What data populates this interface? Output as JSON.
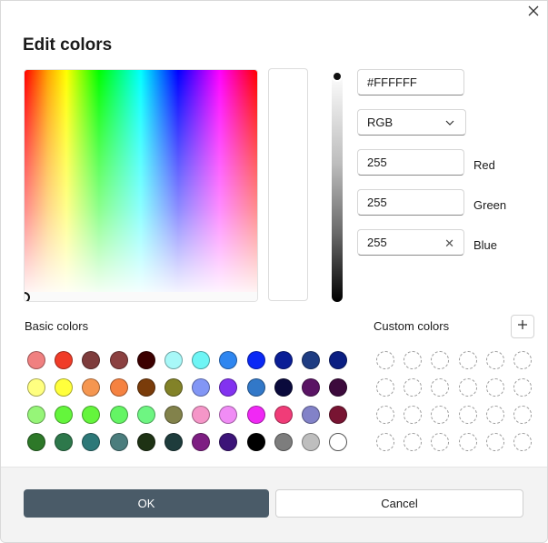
{
  "dialog": {
    "title": "Edit colors",
    "close_icon": "close-icon"
  },
  "color": {
    "hex_value": "#FFFFFF",
    "mode": "RGB",
    "red": "255",
    "green": "255",
    "blue": "255",
    "red_label": "Red",
    "green_label": "Green",
    "blue_label": "Blue"
  },
  "basic_colors": {
    "label": "Basic colors",
    "rows": [
      [
        "#f08080",
        "#f03c28",
        "#7e3c3c",
        "#8b4040",
        "#3c0000",
        "#a8f8f8",
        "#6ef5f5",
        "#2e86f0",
        "#0a28f5",
        "#0a1e96",
        "#1e3c82",
        "#0a1e82"
      ],
      [
        "#ffff80",
        "#ffff3c",
        "#f59650",
        "#f58241",
        "#7a3c0a",
        "#828228",
        "#8296f5",
        "#8232f0",
        "#3278c8",
        "#0a0a3c",
        "#5a1464",
        "#3c0a3c"
      ],
      [
        "#96f578",
        "#64f53c",
        "#64f53c",
        "#64f564",
        "#6ef582",
        "#82824b",
        "#f596c8",
        "#f08cf5",
        "#f028f5",
        "#f03c78",
        "#8282c8",
        "#781432"
      ],
      [
        "#2d7828",
        "#2d784b",
        "#2d7878",
        "#4b7d7d",
        "#1e3214",
        "#1e3c3c",
        "#7d1e82",
        "#3c1478",
        "#000000",
        "#7d7d7d",
        "#bebebe",
        "#ffffff"
      ]
    ]
  },
  "custom_colors": {
    "label": "Custom colors",
    "add_icon": "plus-icon",
    "slots_per_row": 6,
    "rows": 4
  },
  "buttons": {
    "ok": "OK",
    "cancel": "Cancel"
  },
  "colors": {
    "primary_button": "#4a5b68",
    "footer_bg": "#f3f3f3"
  }
}
